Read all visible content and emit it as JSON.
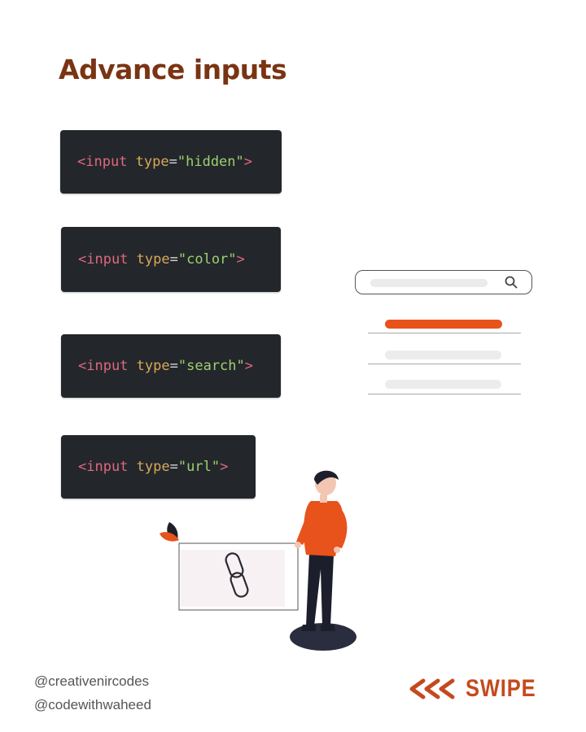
{
  "title": "Advance inputs",
  "code_blocks": [
    {
      "open": "<input",
      "attr": "type",
      "eq": "=",
      "value": "\"hidden\"",
      "close": ">"
    },
    {
      "open": "<input",
      "attr": "type",
      "eq": "=",
      "value": "\"color\"",
      "close": ">"
    },
    {
      "open": "<input",
      "attr": "type",
      "eq": "=",
      "value": "\"search\"",
      "close": ">"
    },
    {
      "open": "<input",
      "attr": "type",
      "eq": "=",
      "value": "\"url\"",
      "close": ">"
    }
  ],
  "handles": [
    "@creativenircodes",
    "@codewithwaheed"
  ],
  "swipe": {
    "label": "SWIPE",
    "arrow_icon": "triple-chevron-left-icon"
  },
  "colors": {
    "title": "#7a3413",
    "code_bg": "#23272b",
    "tag": "#e0677f",
    "attr": "#d9a857",
    "string": "#9ecf6f",
    "accent": "#e8521b",
    "swipe": "#c44a1e"
  },
  "illustration": {
    "search_icon": "magnifier-icon",
    "link_icon": "chain-link-icon",
    "person": "person-illustration"
  }
}
